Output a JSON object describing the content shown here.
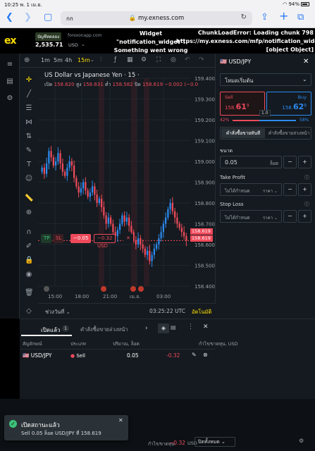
{
  "ios": {
    "time": "10:25",
    "date": "พ. 1 เม.ย.",
    "battery": "94%"
  },
  "safari": {
    "aa": "กก",
    "url": "my.exness.com"
  },
  "header": {
    "logo": "ex",
    "account_type": "บัญชีทดลอง",
    "server": "forexonapp.com",
    "balance": "2,535.71",
    "currency": "USD",
    "error_widget": "Widget \"notification_widget\": Something went wrong",
    "error_chunk": "ChunkLoadError: Loading chunk 798 https://my.exness.com/mfp/notification_widget [object Object]"
  },
  "chart": {
    "timeframes": [
      "1m",
      "5m",
      "4h",
      "15m"
    ],
    "active_tf": "15m",
    "symbol_title": "US Dollar vs Japanese Yen · 15 ·",
    "ohlc": {
      "o_label": "เปิด",
      "o": "158.620",
      "h_label": "สูง",
      "h": "158.631",
      "l_label": "ต่ำ",
      "l": "158.582",
      "c_label": "ปิด",
      "c": "158.619",
      "chg": "−0.002 (−0.0"
    },
    "y_ticks": [
      "159.400",
      "159.300",
      "159.200",
      "159.100",
      "159.000",
      "158.900",
      "158.800",
      "158.700",
      "158.600",
      "158.500",
      "158.400"
    ],
    "x_ticks": [
      "15:00",
      "18:00",
      "21:00",
      "เม.ย.",
      "03:00"
    ],
    "price_tags": [
      "158.619",
      "158.619"
    ],
    "position_line": {
      "tp": "TP",
      "sl": "SL",
      "qty": "−0.05",
      "pnl": "−0.32 USD",
      "close": "✕"
    },
    "range_label": "ช่วงวันที่",
    "time_label": "03:25:22 UTC",
    "auto_label": "อัตโนมัติ",
    "chart_data": {
      "type": "candlestick",
      "title": "US Dollar vs Japanese Yen · 15",
      "x": [
        "15:00",
        "18:00",
        "21:00",
        "เม.ย.",
        "03:00"
      ],
      "ylim": [
        158.4,
        159.4
      ],
      "last": 158.619
    }
  },
  "panel": {
    "symbol": "USD/JPY",
    "mode": "โหมดเริ่มต้น",
    "sell_label": "Sell",
    "sell_price_prefix": "158.",
    "sell_price_big": "61",
    "sell_price_sup": "9",
    "buy_label": "Buy",
    "buy_price_prefix": "158.",
    "buy_price_big": "62",
    "buy_price_sup": "9",
    "spread": "1.0",
    "sell_pct": "42%",
    "buy_pct": "58%",
    "sell_pct_value": 0.42,
    "tab_market": "คำสั่งซื้อขายทันที",
    "tab_pending": "คำสั่งซื้อขายล่วงหน้า",
    "volume_label": "ขนาด",
    "volume_value": "0.05",
    "volume_unit": "ล็อต",
    "tp_label": "Take Profit",
    "tp_value": "ไม่ได้กำหนด",
    "tp_unit": "ราคา",
    "sl_label": "Stop Loss",
    "sl_value": "ไม่ได้กำหนด",
    "sl_unit": "ราคา"
  },
  "trades": {
    "tab_open": "เปิดแล้ว",
    "tab_open_count": "1",
    "tab_pending": "คำสั่งซื้อขายล่วงหน้า",
    "headers": [
      "สัญลักษณ์",
      "ประเภท",
      "ปริมาณ, ล็อต",
      "กำไร/ขาดทุน, USD"
    ],
    "row": {
      "symbol": "USD/JPY",
      "type": "Sell",
      "volume": "0.05",
      "pnl": "-0.32"
    }
  },
  "footer": {
    "pnl_label": "กำไร/ขาดทุน",
    "pnl_value": "−0.32",
    "pnl_unit": "USD",
    "close_all": "ปิดทั้งหมด"
  },
  "toast": {
    "title": "เปิดสถานะแล้ว",
    "message": "Sell 0.05 ล็อต USD/JPY ที่ 158.619"
  },
  "colors": {
    "accent": "#ffde02",
    "sell": "#ef4a5b",
    "buy": "#2d8bf0"
  }
}
